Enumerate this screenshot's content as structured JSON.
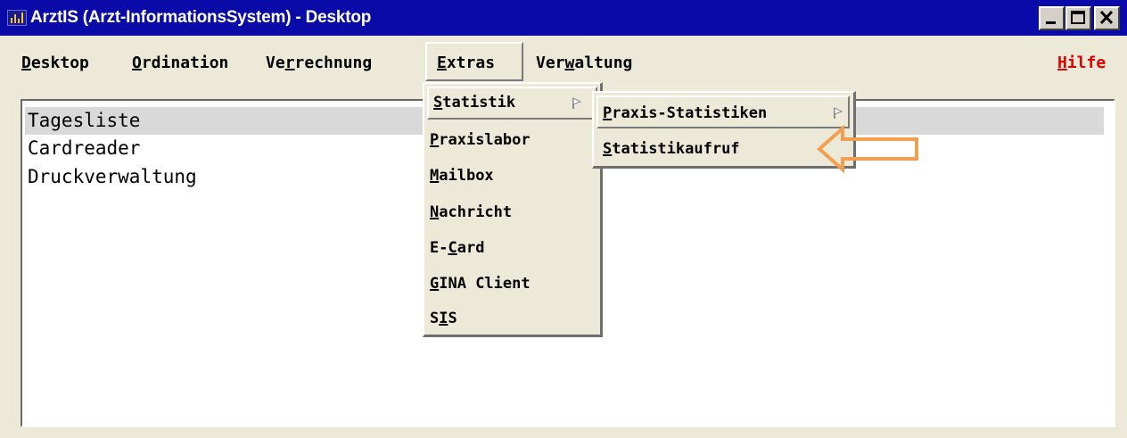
{
  "window": {
    "title": "ArztIS (Arzt-InformationsSystem) - Desktop",
    "controls": [
      "minimize-icon",
      "maximize-icon",
      "close-icon"
    ]
  },
  "menubar": {
    "items": [
      {
        "pre": "",
        "key": "D",
        "post": "esktop"
      },
      {
        "pre": "",
        "key": "O",
        "post": "rdination"
      },
      {
        "pre": "Ve",
        "key": "r",
        "post": "rechnung"
      },
      {
        "pre": "",
        "key": "E",
        "post": "xtras"
      },
      {
        "pre": "Ver",
        "key": "w",
        "post": "altung"
      }
    ],
    "help": {
      "pre": "",
      "key": "H",
      "post": "ilfe"
    }
  },
  "list": {
    "items": [
      "Tagesliste",
      "Cardreader",
      "Druckverwaltung"
    ],
    "selected_index": 0
  },
  "extras_menu": {
    "items": [
      {
        "pre": "",
        "key": "S",
        "post": "tatistik",
        "submenu": true
      },
      {
        "pre": "",
        "key": "P",
        "post": "raxislabor"
      },
      {
        "pre": "",
        "key": "M",
        "post": "ailbox"
      },
      {
        "pre": "",
        "key": "N",
        "post": "achricht"
      },
      {
        "pre": "E-",
        "key": "C",
        "post": "ard"
      },
      {
        "pre": "",
        "key": "G",
        "post": "INA Client"
      },
      {
        "pre": "S",
        "key": "I",
        "post": "S"
      }
    ]
  },
  "statistik_submenu": {
    "items": [
      {
        "pre": "",
        "key": "P",
        "post": "raxis-Statistiken",
        "submenu": true
      },
      {
        "pre": "",
        "key": "S",
        "post": "tatistikaufruf"
      }
    ]
  },
  "colors": {
    "titlebar": "#0a0aa8",
    "window_bg": "#ece9d8",
    "help_text": "#e00000",
    "callout_arrow": "#f0a050"
  }
}
